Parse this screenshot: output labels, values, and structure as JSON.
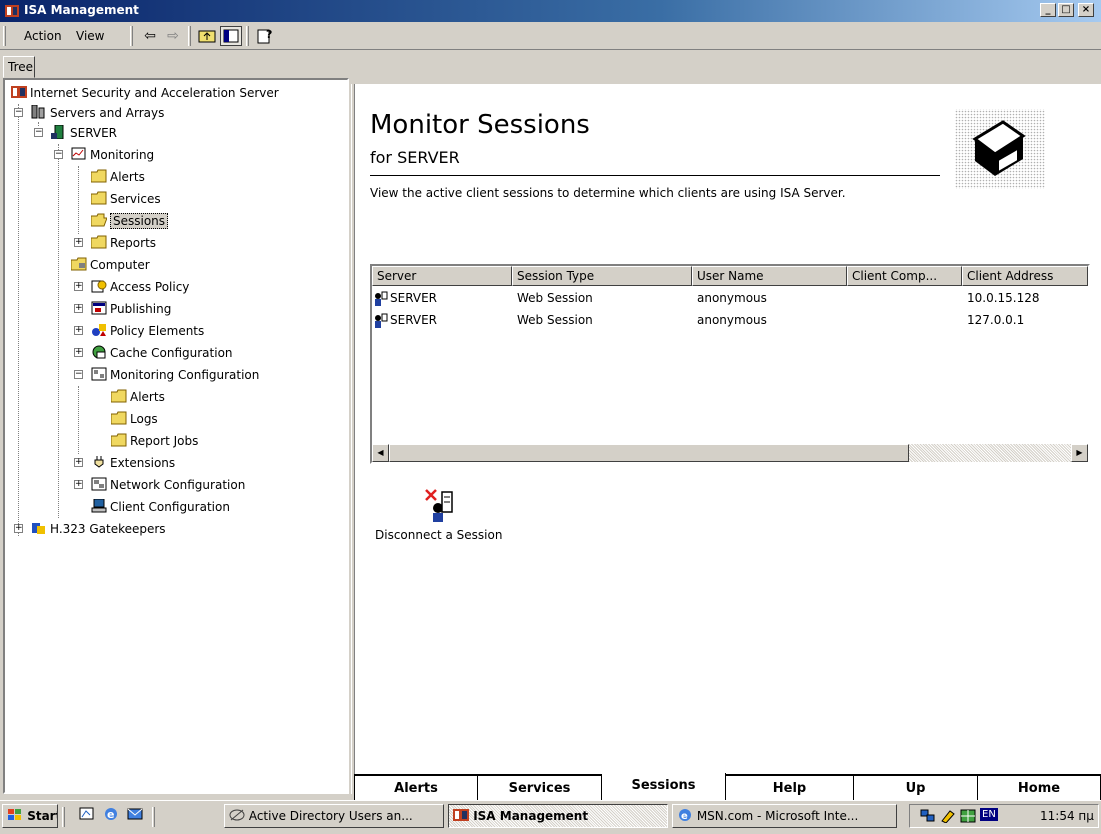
{
  "window": {
    "title": "ISA Management",
    "min": "_",
    "max": "□",
    "close": "×"
  },
  "menu": {
    "action": "Action",
    "view": "View"
  },
  "toolbar": {
    "back": "⇦",
    "forward": "⇨"
  },
  "tree": {
    "tab_label": "Tree",
    "items": [
      "Internet Security and Acceleration Server",
      "Servers and Arrays",
      "SERVER",
      "Monitoring",
      "Alerts",
      "Services",
      "Sessions",
      "Reports",
      "Computer",
      "Access Policy",
      "Publishing",
      "Policy Elements",
      "Cache Configuration",
      "Monitoring Configuration",
      "Alerts",
      "Logs",
      "Report Jobs",
      "Extensions",
      "Network Configuration",
      "Client Configuration",
      "H.323 Gatekeepers"
    ]
  },
  "main": {
    "title": "Monitor Sessions",
    "subtitle": "for SERVER",
    "description": "View the active client sessions to determine which clients are using ISA Server.",
    "columns": [
      "Server",
      "Session Type",
      "User Name",
      "Client Comp...",
      "Client Address"
    ],
    "rows": [
      {
        "server": "SERVER",
        "type": "Web Session",
        "user": "anonymous",
        "comp": "",
        "address": "10.0.15.128"
      },
      {
        "server": "SERVER",
        "type": "Web Session",
        "user": "anonymous",
        "comp": "",
        "address": "127.0.0.1"
      }
    ],
    "action_label": "Disconnect a Session"
  },
  "bottom_tabs": [
    "Alerts",
    "Services",
    "Sessions",
    "Help",
    "Up",
    "Home"
  ],
  "taskbar": {
    "start": "Start",
    "tasks": [
      "Active Directory Users an...",
      "ISA Management",
      "MSN.com - Microsoft Inte..."
    ],
    "lang": "EN",
    "clock": "11:54 пμ"
  }
}
